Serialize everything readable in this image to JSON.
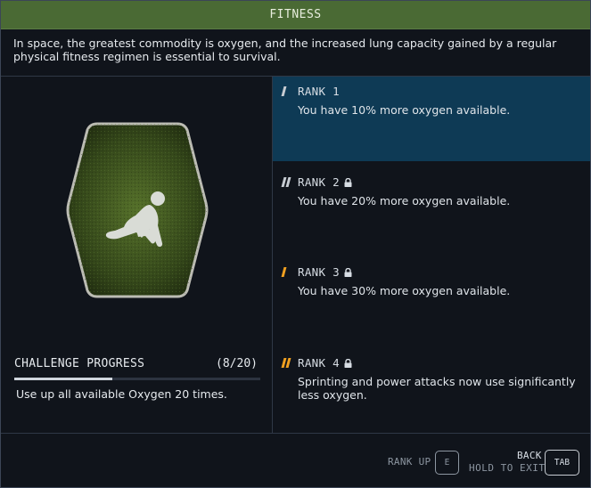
{
  "header": {
    "title": "FITNESS"
  },
  "description": "In space, the greatest commodity is oxygen, and the increased lung capacity gained by a regular physical fitness regimen is essential to survival.",
  "badge": {
    "icon": "crouching-figure-icon"
  },
  "challenge": {
    "title": "CHALLENGE PROGRESS",
    "count": "(8/20)",
    "progress": 0.4,
    "description": "Use up all available Oxygen 20 times."
  },
  "ranks": [
    {
      "label": "RANK 1",
      "text": "You have 10% more oxygen available.",
      "locked": false,
      "active": true,
      "bars": [
        "white"
      ]
    },
    {
      "label": "RANK 2",
      "text": "You have 20% more oxygen available.",
      "locked": true,
      "active": false,
      "bars": [
        "white",
        "white"
      ]
    },
    {
      "label": "RANK 3",
      "text": "You have 30% more oxygen available.",
      "locked": true,
      "active": false,
      "bars": [
        "orange"
      ]
    },
    {
      "label": "RANK 4",
      "text": "Sprinting and power attacks now use significantly less oxygen.",
      "locked": true,
      "active": false,
      "bars": [
        "orange",
        "orange"
      ]
    }
  ],
  "footer": {
    "rank_up_label": "RANK UP",
    "rank_up_key": "E",
    "back_label": "BACK",
    "hold_label": "HOLD TO EXIT",
    "back_key": "TAB"
  },
  "colors": {
    "title_bar": "#4a6a34",
    "active_rank": "#0e3a55",
    "accent_orange": "#f0a020"
  }
}
